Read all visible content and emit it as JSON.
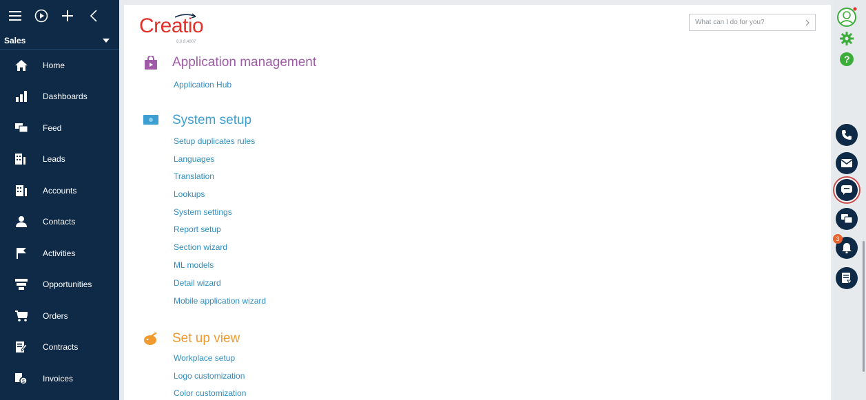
{
  "sidebar": {
    "workspace": "Sales",
    "items": [
      {
        "label": "Home",
        "icon": "home-icon"
      },
      {
        "label": "Dashboards",
        "icon": "dashboards-icon"
      },
      {
        "label": "Feed",
        "icon": "feed-icon"
      },
      {
        "label": "Leads",
        "icon": "leads-icon"
      },
      {
        "label": "Accounts",
        "icon": "accounts-icon"
      },
      {
        "label": "Contacts",
        "icon": "contacts-icon"
      },
      {
        "label": "Activities",
        "icon": "activities-icon"
      },
      {
        "label": "Opportunities",
        "icon": "opportunities-icon"
      },
      {
        "label": "Orders",
        "icon": "orders-icon"
      },
      {
        "label": "Contracts",
        "icon": "contracts-icon"
      },
      {
        "label": "Invoices",
        "icon": "invoices-icon"
      }
    ]
  },
  "header": {
    "logo": "Creatio",
    "version": "8.0.8.4807",
    "search_placeholder": "What can I do for you?"
  },
  "sections": {
    "app_management": {
      "title": "Application management",
      "color": "#a05ba8",
      "links": [
        "Application Hub"
      ]
    },
    "system_setup": {
      "title": "System setup",
      "color": "#3d9fd1",
      "links": [
        "Setup duplicates rules",
        "Languages",
        "Translation",
        "Lookups",
        "System settings",
        "Report setup",
        "Section wizard",
        "ML models",
        "Detail wizard",
        "Mobile application wizard"
      ]
    },
    "set_up_view": {
      "title": "Set up view",
      "color": "#f09a2f",
      "links": [
        "Workplace setup",
        "Logo customization",
        "Color customization"
      ]
    }
  },
  "rightbar": {
    "notification_count": "3",
    "icons": [
      "phone-icon",
      "email-icon",
      "chat-icon",
      "feed-icon",
      "bell-icon",
      "document-icon"
    ]
  },
  "colors": {
    "sidebar_bg": "#0e2a47",
    "link": "#2f8dbf",
    "brand": "#e1322c",
    "green": "#3cad3a"
  }
}
